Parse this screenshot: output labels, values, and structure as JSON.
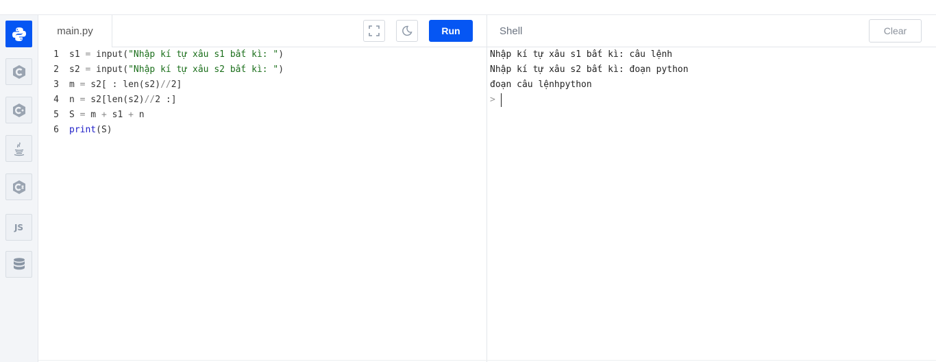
{
  "sidebar": {
    "items": [
      {
        "name": "python-icon",
        "label": ""
      },
      {
        "name": "c-icon",
        "label": ""
      },
      {
        "name": "cpp-icon",
        "label": ""
      },
      {
        "name": "java-icon",
        "label": ""
      },
      {
        "name": "csharp-icon",
        "label": ""
      },
      {
        "name": "javascript-icon",
        "label": "JS"
      },
      {
        "name": "database-icon",
        "label": ""
      }
    ],
    "active_color": "#0556f3"
  },
  "editor": {
    "filename": "main.py",
    "run_label": "Run",
    "fullscreen_icon": "fullscreen-icon",
    "theme_icon": "moon-icon",
    "lines": [
      {
        "n": "1",
        "parts": [
          [
            "",
            "s1 "
          ],
          [
            "op",
            "="
          ],
          [
            "",
            " input("
          ],
          [
            "str",
            "\"Nhập kí tự xâu s1 bất kì: \""
          ],
          [
            "",
            ")"
          ]
        ]
      },
      {
        "n": "2",
        "parts": [
          [
            "",
            "s2 "
          ],
          [
            "op",
            "="
          ],
          [
            "",
            " input("
          ],
          [
            "str",
            "\"Nhập kí tự xâu s2 bất kì: \""
          ],
          [
            "",
            ")"
          ]
        ]
      },
      {
        "n": "3",
        "parts": [
          [
            "",
            "m "
          ],
          [
            "op",
            "="
          ],
          [
            "",
            " s2[ : len(s2)"
          ],
          [
            "op",
            "//"
          ],
          [
            "",
            "2]"
          ]
        ]
      },
      {
        "n": "4",
        "parts": [
          [
            "",
            "n "
          ],
          [
            "op",
            "="
          ],
          [
            "",
            " s2[len(s2)"
          ],
          [
            "op",
            "//"
          ],
          [
            "",
            "2 :]"
          ]
        ]
      },
      {
        "n": "5",
        "parts": [
          [
            "",
            "S "
          ],
          [
            "op",
            "="
          ],
          [
            "",
            " m "
          ],
          [
            "op",
            "+"
          ],
          [
            "",
            " s1 "
          ],
          [
            "op",
            "+"
          ],
          [
            "",
            " n"
          ]
        ]
      },
      {
        "n": "6",
        "parts": [
          [
            "kw",
            "print"
          ],
          [
            "",
            "(S)"
          ]
        ]
      }
    ]
  },
  "shell": {
    "title": "Shell",
    "clear_label": "Clear",
    "output": [
      "Nhập kí tự xâu s1 bất kì: câu lệnh",
      "Nhập kí tự xâu s2 bất kì: đoạn python",
      "đoạn câu lệnhpython"
    ],
    "prompt": ">"
  }
}
